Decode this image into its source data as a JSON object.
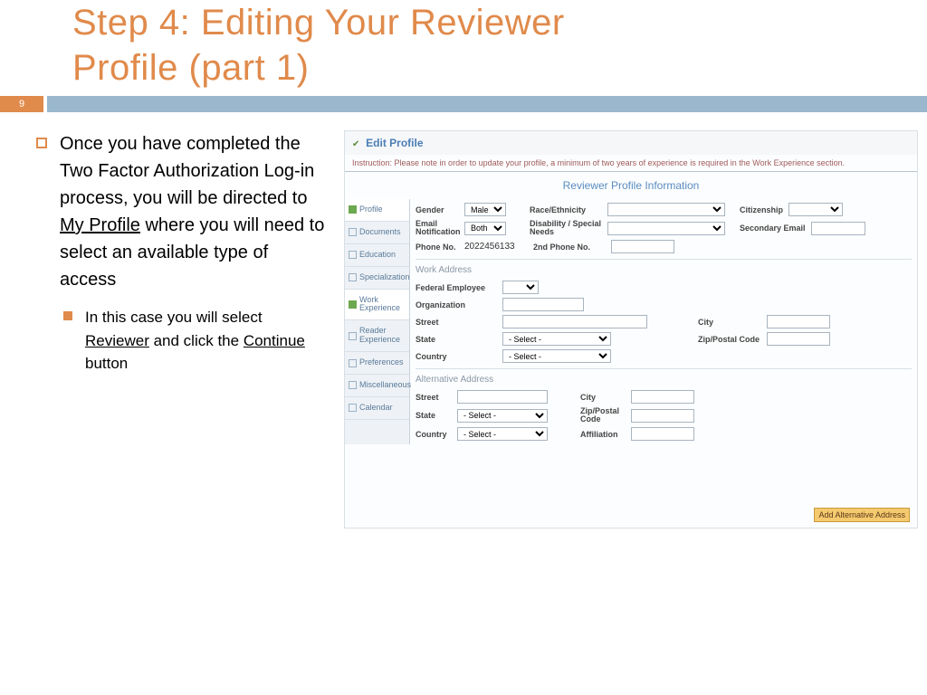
{
  "slide": {
    "title_l1": "Step 4: Editing Your Reviewer",
    "title_l2": "Profile (part 1)",
    "page_number": "9",
    "bullet1_a": "Once you have completed the Two Factor Authorization Log-in process, you will be directed to ",
    "bullet1_u1": "My Profile",
    "bullet1_b": " where you will need to select an available type of access",
    "bullet2_a": "In this case you will select ",
    "bullet2_u1": "Reviewer",
    "bullet2_b": " and click the ",
    "bullet2_u2": "Continue",
    "bullet2_c": " button"
  },
  "panel": {
    "heading": "Edit Profile",
    "instruction": "Instruction: Please note in order to update your profile, a minimum of two years of experience is required in the Work Experience section.",
    "section_title": "Reviewer Profile Information",
    "sidebar": [
      {
        "label": "Profile",
        "active": true
      },
      {
        "label": "Documents"
      },
      {
        "label": "Education"
      },
      {
        "label": "Specialization"
      },
      {
        "label": "Work Experience",
        "active": true
      },
      {
        "label": "Reader Experience"
      },
      {
        "label": "Preferences"
      },
      {
        "label": "Miscellaneous"
      },
      {
        "label": "Calendar"
      }
    ],
    "row1": {
      "gender_l": "Gender",
      "gender_v": "Male",
      "race_l": "Race/Ethnicity",
      "citizen_l": "Citizenship"
    },
    "row2": {
      "email_l": "Email Notification",
      "email_v": "Both",
      "disab_l": "Disability / Special Needs",
      "sec_l": "Secondary Email"
    },
    "row3": {
      "phone_l": "Phone No.",
      "phone_v": "2022456133",
      "phone2_l": "2nd Phone No."
    },
    "work_addr": "Work Address",
    "wa": {
      "fed_l": "Federal Employee",
      "org_l": "Organization",
      "street_l": "Street",
      "city_l": "City",
      "state_l": "State",
      "state_v": "- Select -",
      "zip_l": "Zip/Postal Code",
      "country_l": "Country",
      "country_v": "- Select -"
    },
    "alt_addr": "Alternative Address",
    "aa": {
      "street_l": "Street",
      "city_l": "City",
      "state_l": "State",
      "state_v": "- Select -",
      "zip_l": "Zip/Postal Code",
      "country_l": "Country",
      "country_v": "- Select -",
      "aff_l": "Affiliation"
    },
    "add_btn": "Add Alternative Address"
  }
}
